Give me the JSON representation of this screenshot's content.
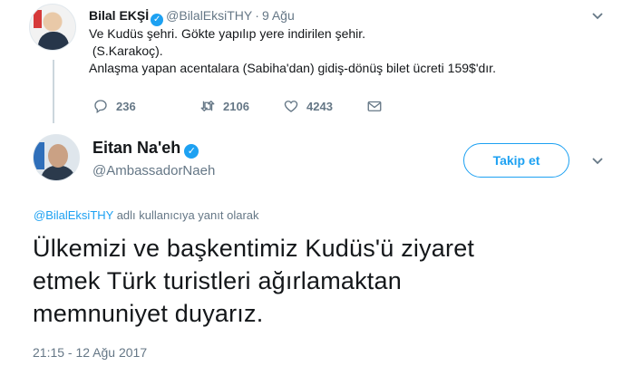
{
  "parent_tweet": {
    "name": "Bilal EKŞİ",
    "verified_mark": "✓",
    "handle": "@BilalEksiTHY",
    "separator": "·",
    "time": "9 Ağu",
    "text_lines": [
      "Ve Kudüs şehri. Gökte yapılıp yere indirilen şehir.",
      " (S.Karakoç).",
      "Anlaşma yapan acentalara (Sabiha'dan) gidiş-dönüş bilet ücreti 159$'dır."
    ],
    "actions": {
      "replies": "236",
      "retweets": "2106",
      "likes": "4243"
    }
  },
  "main_tweet": {
    "name": "Eitan Na'eh",
    "verified_mark": "✓",
    "handle": "@AmbassadorNaeh",
    "follow_label": "Takip et",
    "reply_mention": "@BilalEksiTHY",
    "reply_suffix": " adlı kullanıcıya yanıt olarak",
    "text_lines": [
      "Ülkemizi ve başkentimiz Kudüs'ü ziyaret",
      "etmek Türk turistleri ağırlamaktan",
      "memnuniyet duyarız."
    ],
    "timestamp": "21:15 - 12 Ağu 2017"
  },
  "icons": {
    "chevron": "⌄"
  },
  "colors": {
    "accent": "#1da1f2",
    "muted": "#657786",
    "text": "#14171a"
  }
}
